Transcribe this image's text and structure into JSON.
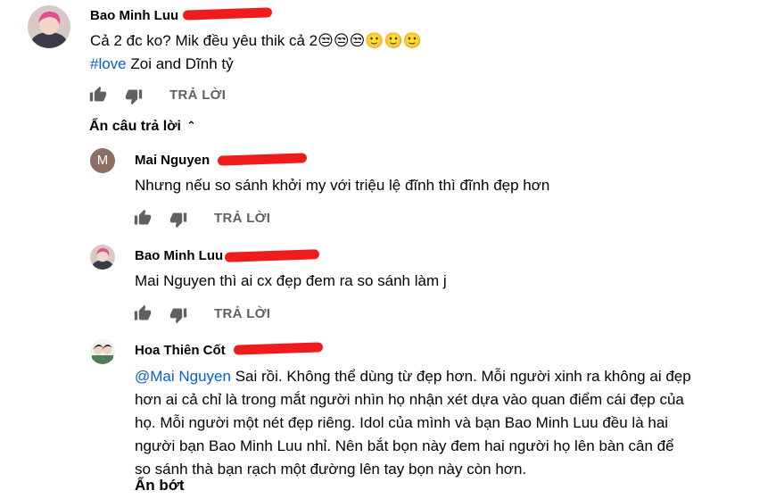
{
  "comments": [
    {
      "author": "Bao Minh Luu",
      "lines": [
        "Cả 2 đc ko? Mik đều yêu thik cả 2😒😒😒🙂🙂🙂"
      ],
      "hashtag": "#love",
      "hashtag_rest": " Zoi and Dĩnh tỷ",
      "reply_label": "TRẢ LỜI"
    }
  ],
  "hide_replies_label": "Ẩn câu trả lời",
  "replies": [
    {
      "author": "Mai Nguyen",
      "avatar_letter": "M",
      "avatar_color": "#8d6e63",
      "text": "Nhưng nếu so sánh khởi my với triệu lệ đĩnh thì đĩnh đẹp hơn",
      "reply_label": "TRẢ LỜI"
    },
    {
      "author": "Bao Minh Luu",
      "text": "Mai Nguyen thì ai cx đẹp đem ra so sánh làm j",
      "reply_label": "TRẢ LỜI"
    },
    {
      "author": "Hoa Thiên Cốt",
      "mention": "@Mai Nguyen",
      "lines": [
        " Sai rồi. Không thể dùng từ đẹp hơn. Mỗi người xinh ra không ai đẹp",
        "hơn ai cả chỉ là trong mắt người nhìn họ nhận xét dựa vào quan điểm cái đẹp của",
        "họ. Mỗi người một nét đẹp riêng. Idol của mình và bạn Bao Minh Luu đều là hai",
        "người bạn Bao Minh Luu nhỉ. Nên bắt bọn này đem hai người họ lên bàn cân để",
        "so sánh thà bạn rạch một đường lên tay bọn này còn hơn."
      ],
      "show_less_label": "Ẩn bớt"
    }
  ],
  "colors": {
    "redaction": "#ee1c1c",
    "link": "#065fd4",
    "icon_gray": "#606060"
  }
}
